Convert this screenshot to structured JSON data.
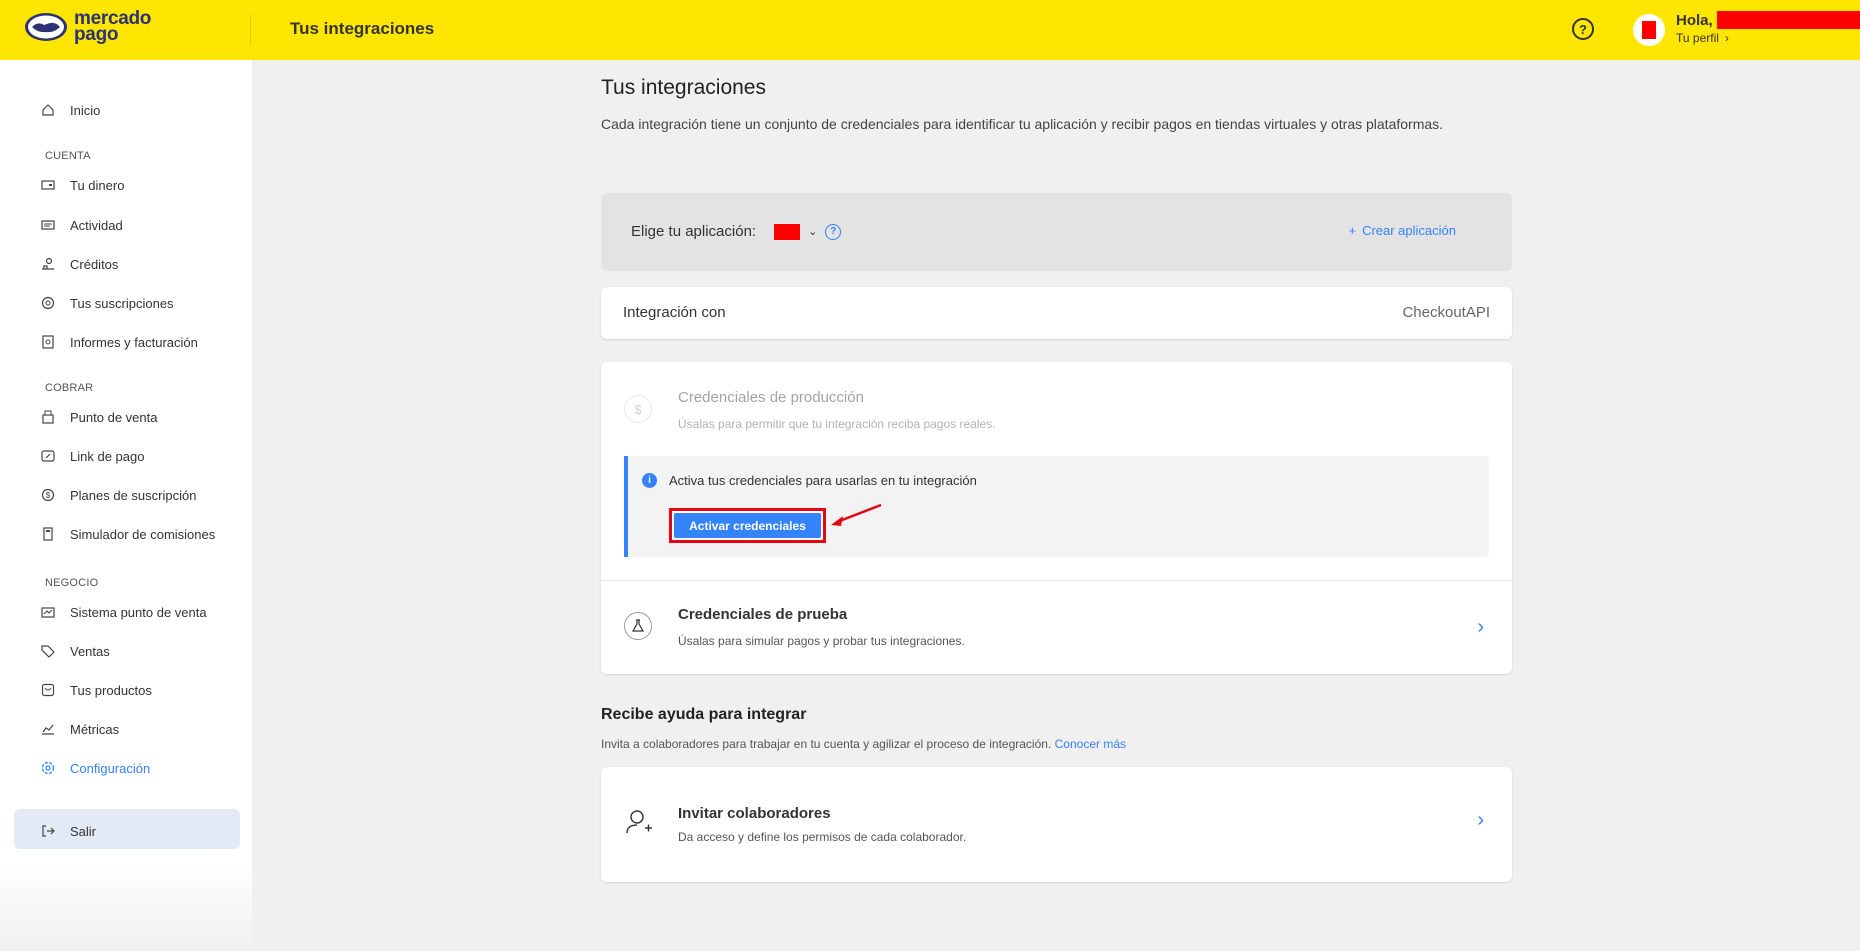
{
  "header": {
    "logo_line1": "mercado",
    "logo_line2": "pago",
    "title": "Tus integraciones",
    "help": "?",
    "greeting": "Hola,",
    "profile": "Tu perfil",
    "profile_chevron": "›"
  },
  "sidebar": {
    "home": "Inicio",
    "sections": [
      "CUENTA",
      "COBRAR",
      "NEGOCIO"
    ],
    "cuenta_items": [
      {
        "label": "Tu dinero",
        "icon": "wallet-icon"
      },
      {
        "label": "Actividad",
        "icon": "activity-icon"
      },
      {
        "label": "Créditos",
        "icon": "credits-icon"
      },
      {
        "label": "Tus suscripciones",
        "icon": "subscriptions-icon"
      },
      {
        "label": "Informes y facturación",
        "icon": "reports-icon"
      }
    ],
    "cobrar_items": [
      {
        "label": "Punto de venta",
        "icon": "point-of-sale-icon"
      },
      {
        "label": "Link de pago",
        "icon": "payment-link-icon"
      },
      {
        "label": "Planes de suscripción",
        "icon": "subscription-plans-icon"
      },
      {
        "label": "Simulador de comisiones",
        "icon": "calculator-icon"
      }
    ],
    "negocio_items": [
      {
        "label": "Sistema punto de venta",
        "icon": "pos-system-icon"
      },
      {
        "label": "Ventas",
        "icon": "tag-icon"
      },
      {
        "label": "Tus productos",
        "icon": "products-icon"
      },
      {
        "label": "Métricas",
        "icon": "metrics-icon"
      },
      {
        "label": "Configuración",
        "icon": "gear-icon"
      }
    ],
    "logout": "Salir"
  },
  "main": {
    "title": "Tus integraciones",
    "description": "Cada integración tiene un conjunto de credenciales para identificar tu aplicación y recibir pagos en tiendas virtuales y otras plataformas.",
    "app_select_label": "Elige tu aplicación:",
    "create_app": "Crear aplicación",
    "integration_label": "Integración con",
    "integration_value": "CheckoutAPI",
    "prod_title": "Credenciales de producción",
    "prod_sub": "Úsalas para permitir que tu integración reciba pagos reales.",
    "notice_text": "Activa tus credenciales para usarlas en tu integración",
    "activate_button": "Activar credenciales",
    "test_title": "Credenciales de prueba",
    "test_sub": "Úsalas para simular pagos y probar tus integraciones.",
    "help_title": "Recibe ayuda para integrar",
    "help_desc": "Invita a colaboradores para trabajar en tu cuenta y agilizar el proceso de integración.",
    "help_link": "Conocer más",
    "collab_title": "Invitar colaboradores",
    "collab_sub": "Da acceso y define los permisos de cada colaborador."
  },
  "colors": {
    "header_bg": "#ffe600",
    "accent": "#3483fa",
    "highlight": "#e30613"
  }
}
